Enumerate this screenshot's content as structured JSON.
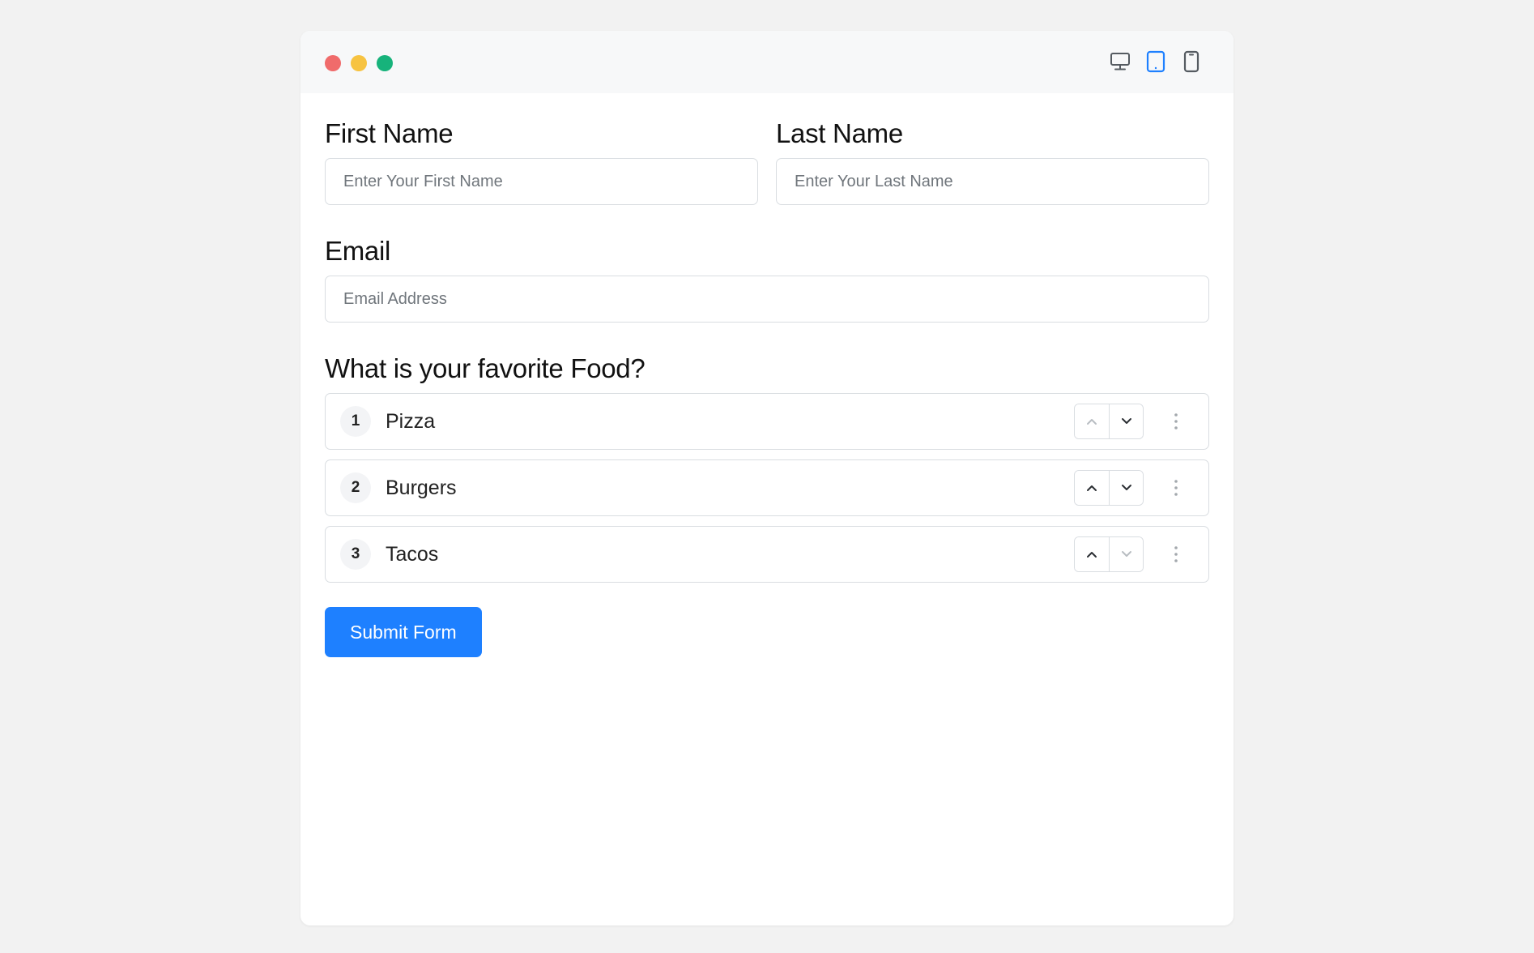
{
  "window": {
    "traffic_lights": [
      {
        "name": "close",
        "color": "#f06b6b"
      },
      {
        "name": "minimize",
        "color": "#f7c341"
      },
      {
        "name": "maximize",
        "color": "#17b37b"
      }
    ],
    "device_switcher": {
      "options": [
        "desktop-icon",
        "tablet-icon",
        "mobile-icon"
      ],
      "selected": "tablet",
      "active_color": "#1e80ff",
      "inactive_color": "#555b61"
    }
  },
  "form": {
    "first_name": {
      "label": "First Name",
      "placeholder": "Enter Your First Name",
      "value": ""
    },
    "last_name": {
      "label": "Last Name",
      "placeholder": "Enter Your Last Name",
      "value": ""
    },
    "email": {
      "label": "Email",
      "placeholder": "Email Address",
      "value": ""
    },
    "food": {
      "question": "What is your favorite Food?",
      "items": [
        {
          "rank": "1",
          "label": "Pizza",
          "up_enabled": false,
          "down_enabled": true
        },
        {
          "rank": "2",
          "label": "Burgers",
          "up_enabled": true,
          "down_enabled": true
        },
        {
          "rank": "3",
          "label": "Tacos",
          "up_enabled": true,
          "down_enabled": false
        }
      ]
    },
    "submit_label": "Submit Form"
  },
  "colors": {
    "primary": "#1e80ff",
    "border": "#d9dde1",
    "page_bg": "#f2f2f2"
  }
}
